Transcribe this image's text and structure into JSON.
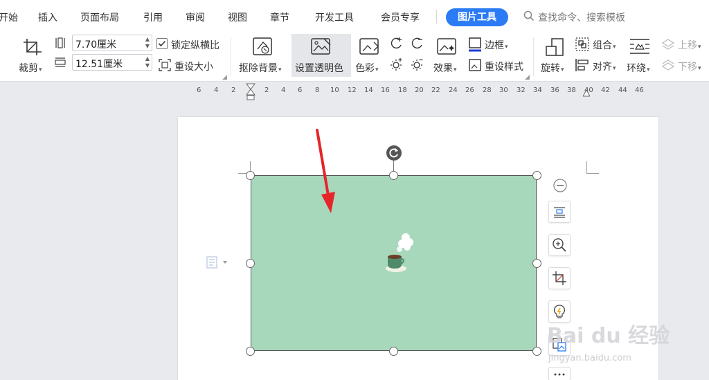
{
  "menu": {
    "tabs": [
      "开始",
      "插入",
      "页面布局",
      "引用",
      "审阅",
      "视图",
      "章节",
      "开发工具",
      "会员专享"
    ],
    "active_tab": "图片工具",
    "search_placeholder": "查找命令、搜索模板"
  },
  "ribbon": {
    "crop_label": "裁剪",
    "width_value": "7.70厘米",
    "height_value": "12.51厘米",
    "lock_ratio_label": "锁定纵横比",
    "lock_ratio_checked": true,
    "reset_size_label": "重设大小",
    "remove_bg_label": "抠除背景",
    "set_transparent_label": "设置透明色",
    "color_label": "色彩",
    "effects_label": "效果",
    "border_label": "边框",
    "reset_style_label": "重设样式",
    "rotate_label": "旋转",
    "group_label": "组合",
    "align_label": "对齐",
    "wrap_label": "环绕",
    "move_up_label": "上移",
    "move_down_label": "下移"
  },
  "ruler": {
    "numbers": [
      "6",
      "4",
      "2",
      "2",
      "4",
      "6",
      "8",
      "10",
      "12",
      "14",
      "16",
      "18",
      "20",
      "22",
      "24",
      "26",
      "28",
      "30",
      "32",
      "34",
      "36",
      "38",
      "40",
      "42",
      "44",
      "46"
    ]
  },
  "image": {
    "fill_color": "#a8d8bc"
  },
  "colors": {
    "accent": "#2b7bf5",
    "arrow": "#e4262a"
  },
  "watermark": {
    "brand": "Bai du 经验",
    "url": "jingyan.baidu.com"
  }
}
